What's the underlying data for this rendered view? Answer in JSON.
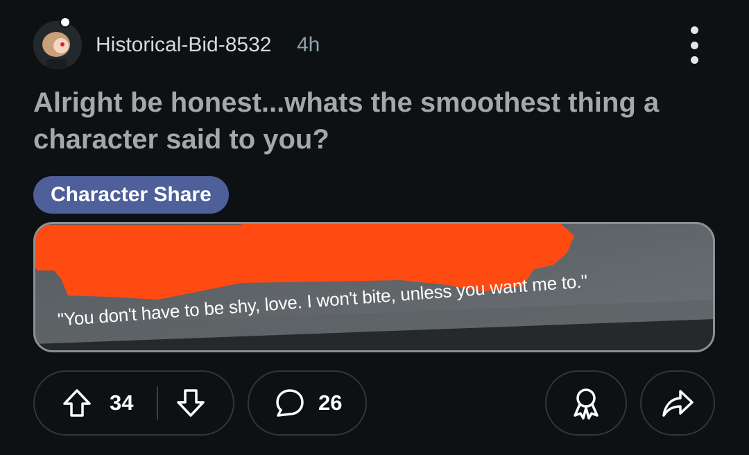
{
  "post": {
    "username": "Historical-Bid-8532",
    "time_ago": "4h",
    "title": "Alright be honest...whats the smoothest thing a character said to you?",
    "flair": "Character Share",
    "flair_color": "#4e5f99",
    "image_quote": "\"You don't have to be shy, love. I won't bite, unless you want me to.\"",
    "redaction_color": "#ff4b12"
  },
  "actions": {
    "upvote_icon": "arrow-up-icon",
    "score": "34",
    "downvote_icon": "arrow-down-icon",
    "comment_icon": "comment-bubble-icon",
    "comment_count": "26",
    "award_icon": "award-icon",
    "share_icon": "share-arrow-icon"
  }
}
